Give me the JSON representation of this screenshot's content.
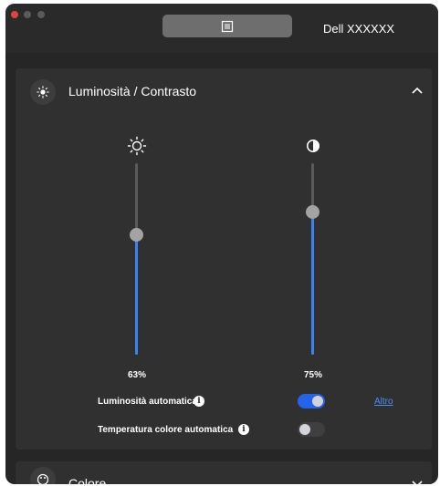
{
  "window": {
    "monitor_name": "Dell XXXXXX"
  },
  "section_brightness": {
    "title": "Luminosità / Contrasto",
    "icon": "brightness-icon",
    "expanded": true
  },
  "sliders": {
    "brightness": {
      "icon": "sun-icon",
      "value_label": "63%",
      "value": 63
    },
    "contrast": {
      "icon": "contrast-icon",
      "value_label": "75%",
      "value": 75
    }
  },
  "auto_brightness": {
    "label": "Luminosità automatica",
    "enabled": true,
    "link_label": "Altro"
  },
  "auto_color_temp": {
    "label": "Temperatura colore automatica",
    "enabled": false
  },
  "section_color": {
    "title": "Colore",
    "expanded": false
  },
  "colors": {
    "accent": "#3b82f6",
    "window_bg": "#262626",
    "panel_bg": "#303030",
    "close_button": "#e0443e"
  }
}
